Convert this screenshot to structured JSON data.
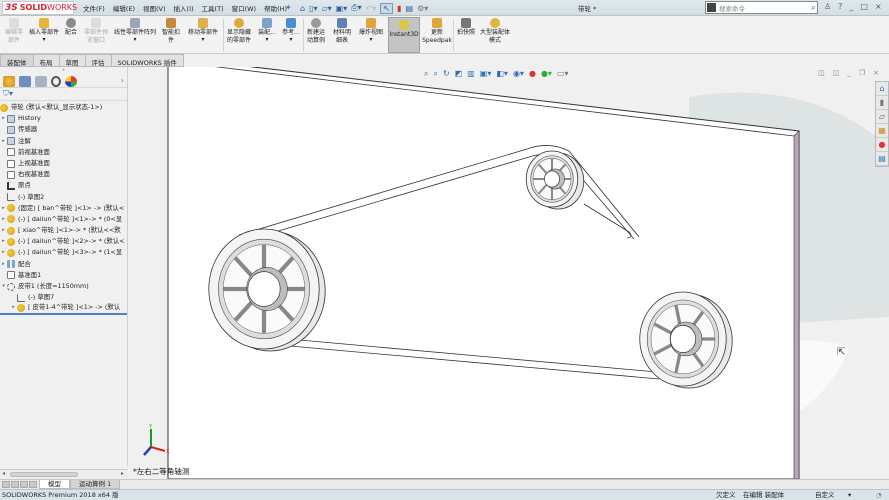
{
  "app": {
    "logo_prefix": "3S",
    "logo_text": "SOLID",
    "logo_text2": "WORKS",
    "doc_title": "带轮 *"
  },
  "menu": [
    "文件(F)",
    "编辑(E)",
    "视图(V)",
    "插入(I)",
    "工具(T)",
    "窗口(W)",
    "帮助(H)"
  ],
  "search": {
    "placeholder": "搜索命令"
  },
  "window_buttons": [
    "?",
    "_",
    "□",
    "×"
  ],
  "ribbon": [
    {
      "label": "编辑零部件",
      "disabled": true
    },
    {
      "label": "插入零部件"
    },
    {
      "label": "配合"
    },
    {
      "label": "零部件预览窗口",
      "disabled": true
    },
    {
      "label": "线性零部件阵列"
    },
    {
      "label": "智能扣件"
    },
    {
      "label": "移动零部件"
    },
    {
      "label": "显示隐藏的零部件"
    },
    {
      "label": "装配..."
    },
    {
      "label": "参考..."
    },
    {
      "label": "新建运动算例"
    },
    {
      "label": "材料明细表"
    },
    {
      "label": "爆炸视图"
    },
    {
      "label": "Instant3D",
      "active": true
    },
    {
      "label": "更新Speedpak"
    },
    {
      "label": "拍快照"
    },
    {
      "label": "大型装配体模式"
    }
  ],
  "command_tabs": [
    "装配体",
    "布局",
    "草图",
    "评估",
    "SOLIDWORKS 插件"
  ],
  "tree": {
    "root": "带轮 (默认<默认_显示状态-1>)",
    "items": [
      {
        "label": "History",
        "type": "folder",
        "expandable": true
      },
      {
        "label": "传感器",
        "type": "folder"
      },
      {
        "label": "注解",
        "type": "folder",
        "expandable": true
      },
      {
        "label": "前视基准面",
        "type": "plane"
      },
      {
        "label": "上视基准面",
        "type": "plane"
      },
      {
        "label": "右视基准面",
        "type": "plane"
      },
      {
        "label": "原点",
        "type": "origin"
      },
      {
        "label": "(-) 草图2",
        "type": "sketch"
      },
      {
        "label": "(固定) [ ban^带轮 ]<1> -> (默认<",
        "type": "asm",
        "expandable": true
      },
      {
        "label": "(-) [ dailun^带轮 ]<1>-> * (0<显",
        "type": "asm",
        "expandable": true
      },
      {
        "label": "[ xiao^带轮 ]<1>-> * (默认<<默",
        "type": "asm",
        "expandable": true
      },
      {
        "label": "(-) [ dailun^带轮 ]<2>-> * (默认<",
        "type": "asm",
        "expandable": true
      },
      {
        "label": "(-) [ dailun^带轮 ]<3>-> * (1<显",
        "type": "asm",
        "expandable": true
      },
      {
        "label": "配合",
        "type": "mate",
        "expandable": true
      },
      {
        "label": "基准面1",
        "type": "plane"
      },
      {
        "label": "皮带1 (长度=1150mm)",
        "type": "belt",
        "expandable": true,
        "expanded": true
      },
      {
        "label": "(-) 草图7",
        "type": "sketch",
        "indent": 1
      },
      {
        "label": "[ 皮带1-4^带轮 ]<1> -> (默认",
        "type": "asm",
        "indent": 1,
        "expandable": true,
        "selected": true
      }
    ]
  },
  "viewport": {
    "view_label": "*左右二等角轴测",
    "axes": {
      "x": "X",
      "y": "Y",
      "z": "Z"
    }
  },
  "bottom_tabs": [
    "模型",
    "运动算例 1"
  ],
  "status": {
    "version": "SOLIDWORKS Premium 2018 x64 版",
    "definition": "欠定义",
    "editing": "在编辑 装配体",
    "units": "自定义",
    "units_arrow": "▾"
  },
  "colors": {
    "titlebar": "#d3dee3",
    "accent_red": "#d6202b",
    "active_ribbon": "#c4c4c4",
    "x_axis": "#e0201c",
    "y_axis": "#1a9a2a",
    "z_axis": "#2040c0"
  }
}
